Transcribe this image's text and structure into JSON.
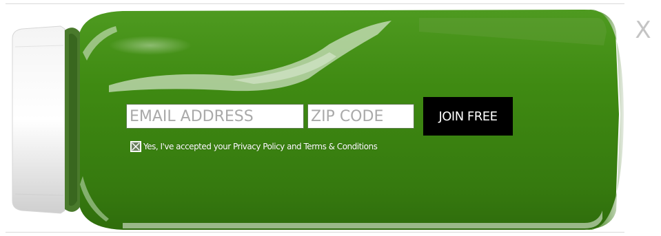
{
  "signup": {
    "email_placeholder": "EMAIL ADDRESS",
    "zip_placeholder": "ZIP CODE",
    "join_label": "JOIN FREE",
    "consent_text": "Yes, I've accepted your Privacy Policy and Terms & Conditions",
    "consent_checked": true
  },
  "close": {
    "label": "X"
  },
  "colors": {
    "juice_green": "#3f8a12",
    "button_black": "#000000",
    "close_gray": "#c4c4c4"
  },
  "icons": {
    "background": "juice-bottle-image",
    "checkbox": "checked-checkbox-icon"
  }
}
